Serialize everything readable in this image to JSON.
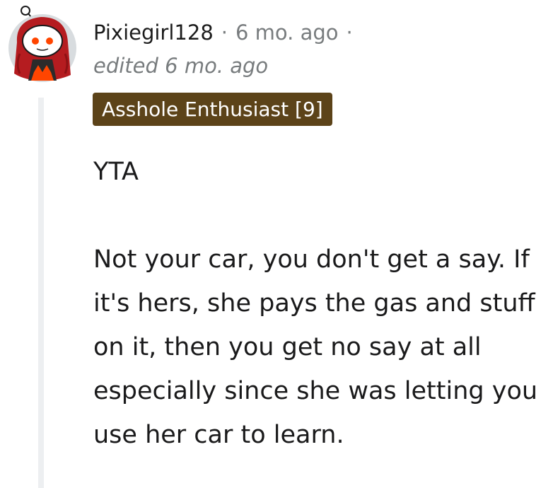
{
  "comment": {
    "username": "Pixiegirl128",
    "separator": "·",
    "time": "6 mo. ago",
    "edited": "edited 6 mo. ago",
    "flair": "Asshole Enthusiast [9]",
    "paragraphs": [
      "YTA",
      "Not your car, you don't get a say. If it's hers, she pays the gas and stuff on it, then you get no say at all especially since she was letting you use her car to learn."
    ]
  },
  "colors": {
    "flair_bg": "#5c4319",
    "meta_text": "#787c7e",
    "thread_line": "#edeff1",
    "avatar_bg": "#d8dcdf",
    "avatar_hair": "#b51c20",
    "avatar_accent": "#ff4500"
  },
  "icons": {
    "avatar": "snoo-avatar-icon"
  }
}
